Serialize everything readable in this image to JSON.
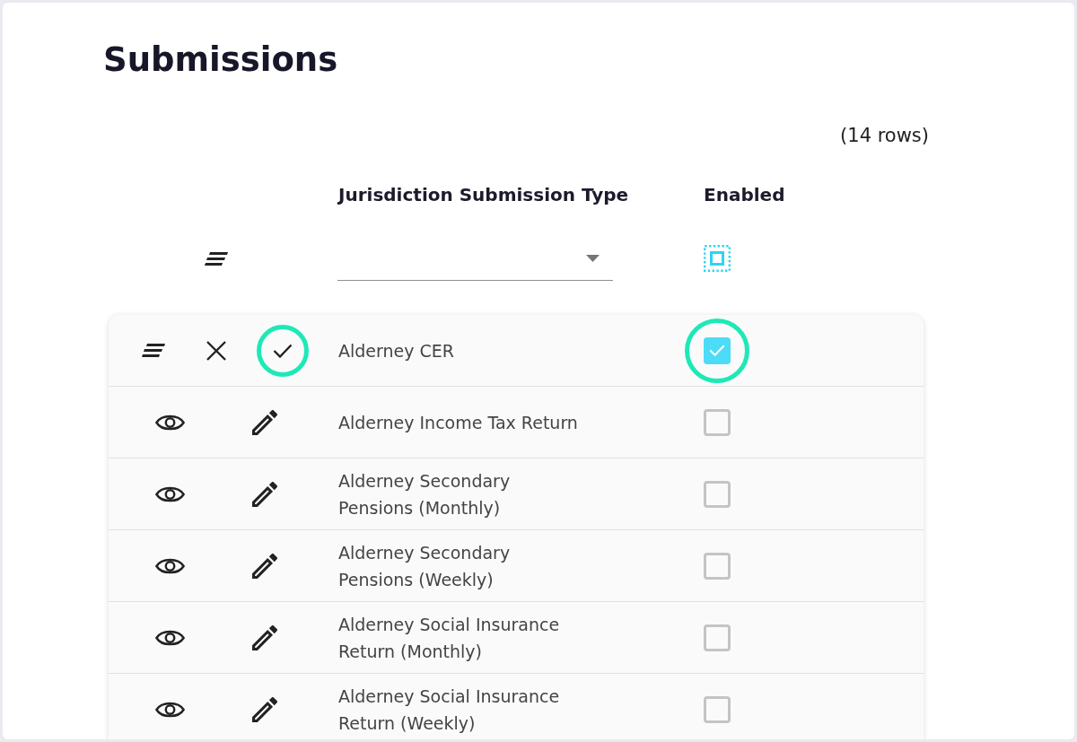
{
  "title": "Submissions",
  "row_count": "(14 rows)",
  "columns": [
    {
      "label": "Jurisdiction Submission Type"
    },
    {
      "label": "Enabled"
    }
  ],
  "rows": [
    {
      "kind": "edit",
      "name": "Alderney CER",
      "enabled": true,
      "highlighted": true
    },
    {
      "kind": "view",
      "name": "Alderney Income Tax Return",
      "enabled": false,
      "highlighted": false
    },
    {
      "kind": "view",
      "name": "Alderney Secondary Pensions (Monthly)",
      "enabled": false,
      "highlighted": false
    },
    {
      "kind": "view",
      "name": "Alderney Secondary Pensions (Weekly)",
      "enabled": false,
      "highlighted": false
    },
    {
      "kind": "view",
      "name": "Alderney Social Insurance Return (Monthly)",
      "enabled": false,
      "highlighted": false
    },
    {
      "kind": "view",
      "name": "Alderney Social Insurance Return (Weekly)",
      "enabled": false,
      "highlighted": false
    }
  ]
}
